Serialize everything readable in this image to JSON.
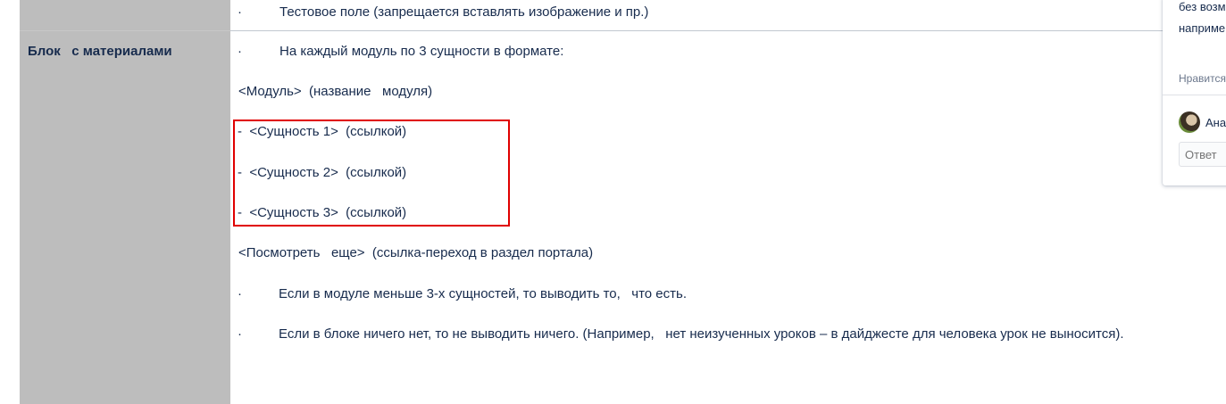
{
  "prev_row": {
    "bullet": "·",
    "text": "Тестовое поле (запрещается вставлять изображение и пр.)"
  },
  "label": "Блок   с материалами",
  "content": {
    "bullet_char": "·",
    "line1": "На каждый модуль по 3 сущности в формате:",
    "line2": "<Модуль>  (название   модуля)",
    "entity1": "-  <Сущность 1>  (ссылкой)",
    "entity2": "-  <Сущность 2>  (ссылкой)",
    "entity3": "-  <Сущность 3>  (ссылкой)",
    "line_more": "<Посмотреть   еще>  (ссылка-переход в раздел портала)",
    "bullet2": "Если в модуле меньше 3-х сущностей, то выводить то,   что есть.",
    "bullet3": "Если в блоке ничего нет, то не выводить ничего. (Например,   нет неизученных уроков – в дайджесте для человека урок не выносится)."
  },
  "comment": {
    "text_line1": "без возм",
    "text_line2": "наприме",
    "like_label": "Нравится",
    "author": "Ана",
    "reply_placeholder": "Ответ"
  },
  "colors": {
    "label_bg": "#bdbdbd",
    "highlight": "#e00000",
    "text": "#172b4d"
  }
}
